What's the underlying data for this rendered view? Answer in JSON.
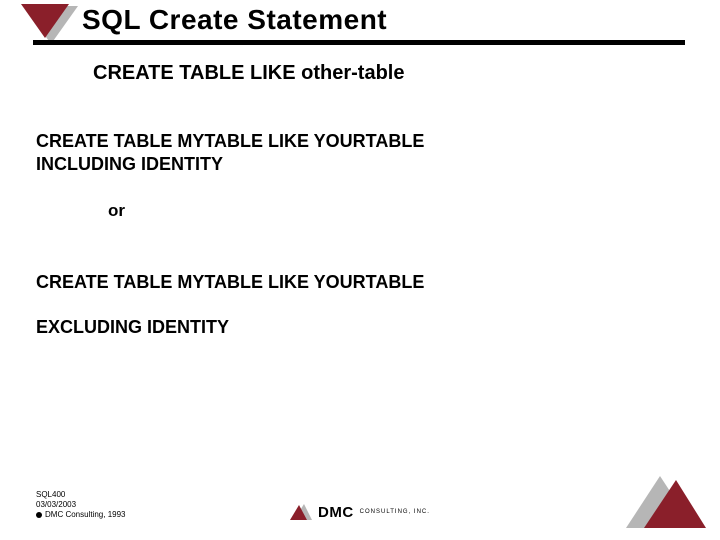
{
  "colors": {
    "maroon": "#8a1f2a",
    "grey": "#b6b6b6",
    "black": "#000000"
  },
  "header": {
    "title": "SQL Create Statement"
  },
  "subtitle": "CREATE TABLE LIKE other-table",
  "body": {
    "block1_line1": "CREATE TABLE MYTABLE LIKE YOURTABLE",
    "block1_line2": "INCLUDING IDENTITY",
    "or": "or",
    "block2_line1": "CREATE TABLE MYTABLE LIKE YOURTABLE",
    "block2_line2": "EXCLUDING IDENTITY"
  },
  "footer": {
    "line1": "SQL400",
    "line2": "03/03/2003",
    "copyright": "DMC Consulting, 1993"
  },
  "logo": {
    "name": "DMC",
    "tagline": "CONSULTING, INC."
  }
}
